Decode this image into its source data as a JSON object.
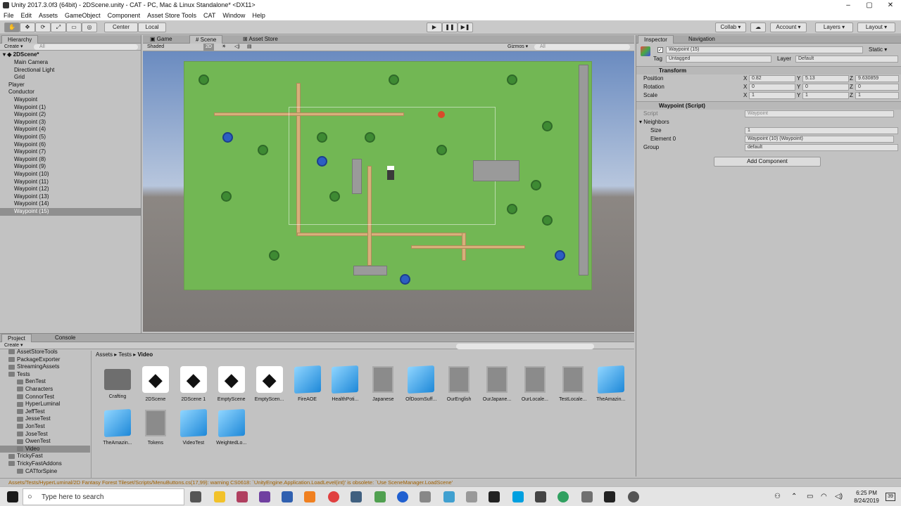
{
  "window": {
    "title": "Unity 2017.3.0f3 (64bit) - 2DScene.unity - CAT - PC, Mac & Linux Standalone* <DX11>"
  },
  "menu": [
    "File",
    "Edit",
    "Assets",
    "GameObject",
    "Component",
    "Asset Store Tools",
    "CAT",
    "Window",
    "Help"
  ],
  "toolbar": {
    "center": "Center",
    "local": "Local",
    "collab": "Collab ▾",
    "account": "Account ▾",
    "layers": "Layers ▾",
    "layout": "Layout ▾"
  },
  "hierarchy": {
    "tab": "Hierarchy",
    "create": "Create ▾",
    "search_placeholder": "All",
    "scene": "2DScene*",
    "items": [
      "Main Camera",
      "Directional Light",
      "Grid",
      "Player",
      "Conductor",
      "Waypoint",
      "Waypoint (1)",
      "Waypoint (2)",
      "Waypoint (3)",
      "Waypoint (4)",
      "Waypoint (5)",
      "Waypoint (6)",
      "Waypoint (7)",
      "Waypoint (8)",
      "Waypoint (9)",
      "Waypoint (10)",
      "Waypoint (11)",
      "Waypoint (12)",
      "Waypoint (13)",
      "Waypoint (14)",
      "Waypoint (15)"
    ]
  },
  "scene": {
    "tabs": [
      "Game",
      "Scene",
      "Asset Store"
    ],
    "shaded": "Shaded",
    "mode2d": "2D",
    "gizmos": "Gizmos ▾",
    "search": "All"
  },
  "inspector": {
    "tabs": [
      "Inspector",
      "Navigation"
    ],
    "object_name": "Waypoint (15)",
    "static": "Static ▾",
    "tag_label": "Tag",
    "tag": "Untagged",
    "layer_label": "Layer",
    "layer": "Default",
    "transform": "Transform",
    "position": {
      "label": "Position",
      "x": "0.82",
      "y": "5.13",
      "z": "9.630859"
    },
    "rotation": {
      "label": "Rotation",
      "x": "0",
      "y": "0",
      "z": "0"
    },
    "scale": {
      "label": "Scale",
      "x": "1",
      "y": "1",
      "z": "1"
    },
    "script_component": "Waypoint (Script)",
    "script_label": "Script",
    "script_value": "Waypoint",
    "neighbors": "Neighbors",
    "size_label": "Size",
    "size": "1",
    "element0_label": "Element 0",
    "element0": "Waypoint (10) (Waypoint)",
    "group_label": "Group",
    "group": "default",
    "add_component": "Add Component"
  },
  "project": {
    "tabs": [
      "Project",
      "Console"
    ],
    "create": "Create ▾",
    "breadcrumb": [
      "Assets",
      "Tests",
      "Video"
    ],
    "tree": [
      "AssetStoreTools",
      "PackageExporter",
      "StreamingAssets",
      "Tests",
      "BenTest",
      "Characters",
      "ConnorTest",
      "HyperLuminal",
      "JeffTest",
      "JesseTest",
      "JonTest",
      "JoseTest",
      "OwenTest",
      "Video",
      "TrickyFast",
      "TrickyFastAddons",
      "CATforSpine"
    ],
    "assets": [
      {
        "name": "Crafting",
        "icon": "dir"
      },
      {
        "name": "2DScene",
        "icon": "unity"
      },
      {
        "name": "2DScene 1",
        "icon": "unity"
      },
      {
        "name": "EmptyScene",
        "icon": "unity"
      },
      {
        "name": "EmptyScen...",
        "icon": "unity"
      },
      {
        "name": "FireAOE",
        "icon": "cube"
      },
      {
        "name": "HealthPoti...",
        "icon": "cube"
      },
      {
        "name": "Japanese",
        "icon": "file"
      },
      {
        "name": "OfDoomSuff...",
        "icon": "cube"
      },
      {
        "name": "OurEnglish",
        "icon": "file"
      },
      {
        "name": "OurJapane...",
        "icon": "file"
      },
      {
        "name": "OurLocale...",
        "icon": "file"
      },
      {
        "name": "TestLocale...",
        "icon": "file"
      },
      {
        "name": "TheAmazin...",
        "icon": "cube"
      },
      {
        "name": "TheAmazin...",
        "icon": "cube"
      },
      {
        "name": "Tokens",
        "icon": "file"
      },
      {
        "name": "VideoTest",
        "icon": "cube"
      },
      {
        "name": "WeightedLo...",
        "icon": "cube"
      }
    ]
  },
  "status": "Assets/Tests/HyperLuminal/2D Fantasy Forest Tileset/Scripts/MenuButtons.cs(17,99): warning CS0618: `UnityEngine.Application.LoadLevel(int)' is obsolete: `Use SceneManager.LoadScene'",
  "taskbar": {
    "search_placeholder": "Type here to search",
    "time": "6:25 PM",
    "date": "8/24/2019",
    "notif": "39"
  }
}
